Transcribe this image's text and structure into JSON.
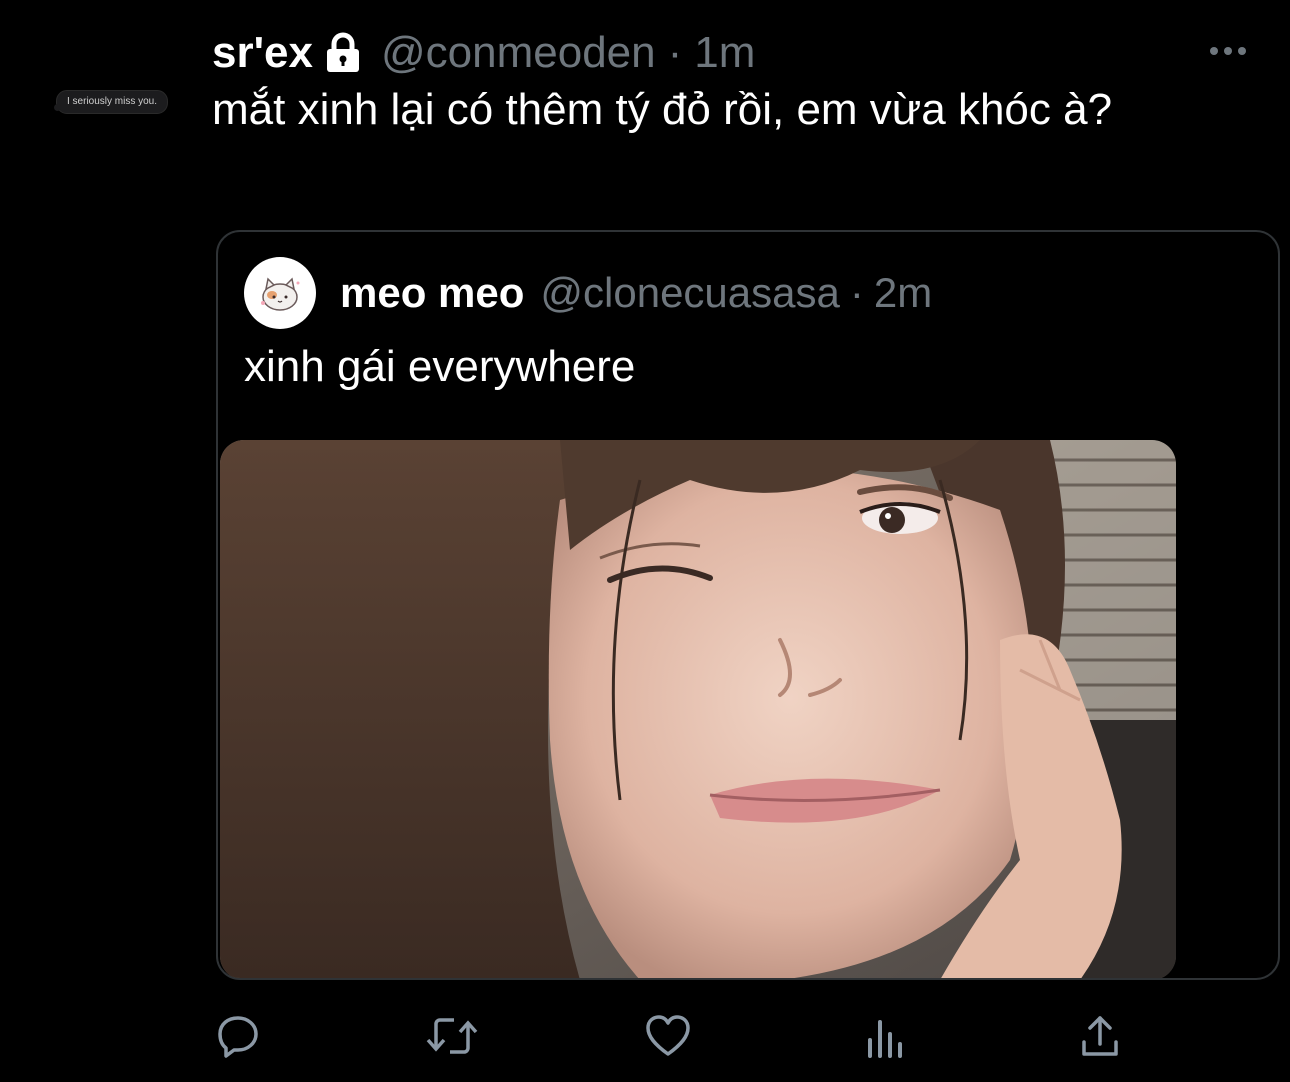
{
  "overlay": {
    "bubble_text": "I seriously miss you."
  },
  "tweet": {
    "display_name": "sr'ex",
    "handle": "@conmeoden",
    "separator": "·",
    "time": "1m",
    "text": "mắt xinh lại có thêm tý đỏ rồi, em vừa khóc à?",
    "icons": {
      "protected": "lock-icon",
      "more": "more-horizontal-icon"
    }
  },
  "quote": {
    "display_name": "meo meo",
    "handle": "@clonecuasasa",
    "separator": "·",
    "time": "2m",
    "text": "xinh gái everywhere"
  },
  "actions": [
    {
      "name": "reply",
      "icon": "reply-icon"
    },
    {
      "name": "retweet",
      "icon": "retweet-icon"
    },
    {
      "name": "like",
      "icon": "heart-icon"
    },
    {
      "name": "analytics",
      "icon": "analytics-icon"
    },
    {
      "name": "share",
      "icon": "share-icon"
    }
  ],
  "colors": {
    "background": "#000000",
    "text": "#ffffff",
    "muted": "#6e767d",
    "border": "#2f3336",
    "icon": "#8b98a5"
  }
}
